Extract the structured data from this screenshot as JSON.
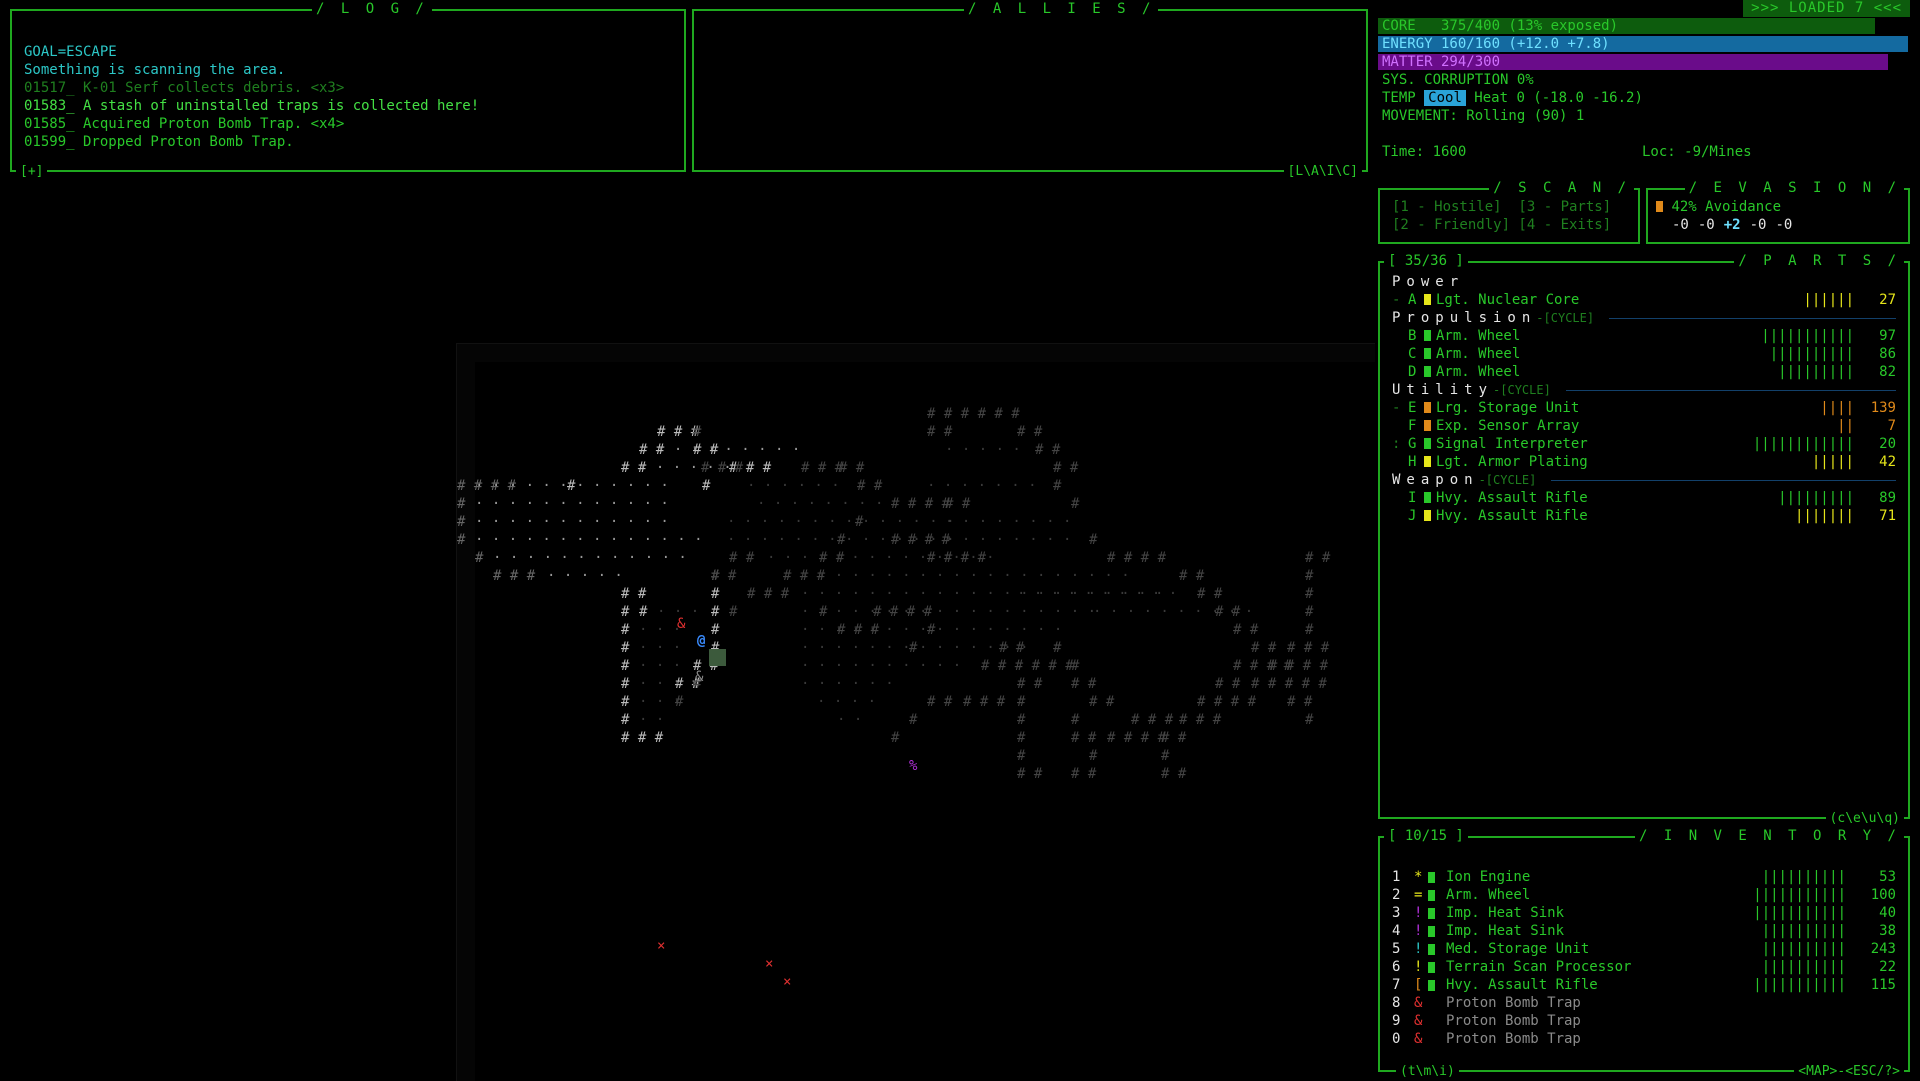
{
  "log": {
    "title": "/ L O G /",
    "footer": "[+]",
    "lines": [
      {
        "text": "GOAL=ESCAPE",
        "color": "#2cc7c7"
      },
      {
        "text": "Something is scanning the area.",
        "color": "#2cc7c7"
      },
      {
        "text": "01517_ K-01 Serf collects debris. <x3>",
        "color": "#1f7f1f"
      },
      {
        "text": "01583_ A stash of uninstalled traps is collected here!",
        "color": "#44e044"
      },
      {
        "text": "01585_ Acquired Proton Bomb Trap. <x4>",
        "color": "#29c82a"
      },
      {
        "text": "01599_ Dropped Proton Bomb Trap.",
        "color": "#29c82a"
      }
    ]
  },
  "allies": {
    "title": "/ A L L I E S /",
    "footer": "[L\\A\\I\\C]"
  },
  "status": {
    "loaded": ">>> LOADED 7 <<<",
    "core": "CORE   375/400 (13% exposed)",
    "energy": "ENERGY 160/160 (+12.0 +7.8)",
    "matter": "MATTER 294/300",
    "corruption": "SYS. CORRUPTION 0%",
    "temp_label": "TEMP ",
    "temp_state": "Cool",
    "heat": " Heat 0 (-18.0 -16.2)",
    "movement": "MOVEMENT: Rolling (90) 1",
    "time": "Time: 1600",
    "loc": "Loc: -9/Mines",
    "core_frac": 0.9375,
    "energy_frac": 1.0,
    "matter_frac": 0.98
  },
  "scan": {
    "title": "/ S C A N /",
    "line1": "[1 - Hostile]  [3 - Parts]",
    "line2": "[2 - Friendly] [4 - Exits]"
  },
  "evasion": {
    "title": "/ E V A S I O N /",
    "avoid": "42% Avoidance",
    "mods": [
      "-0",
      "-0",
      "+2",
      "-0",
      "-0"
    ]
  },
  "parts": {
    "title": "/ P A R T S /",
    "count": "[ 35/36 ]",
    "footer": "(c\\e\\u\\q)",
    "cycle": "-[CYCLE]",
    "categories": [
      {
        "name": "Power",
        "cycle": false,
        "items": [
          {
            "slot": "A",
            "name": "Lgt. Nuclear Core",
            "bars": "||||||",
            "num": "27",
            "sq": "#e6e61a",
            "numc": "#e6e61a",
            "mark": "-"
          }
        ]
      },
      {
        "name": "Propulsion",
        "cycle": true,
        "items": [
          {
            "slot": "B",
            "name": "Arm. Wheel",
            "bars": "|||||||||||",
            "num": "97",
            "sq": "#29c82a",
            "numc": "#29c82a",
            "mark": ""
          },
          {
            "slot": "C",
            "name": "Arm. Wheel",
            "bars": "||||||||||",
            "num": "86",
            "sq": "#29c82a",
            "numc": "#29c82a",
            "mark": ""
          },
          {
            "slot": "D",
            "name": "Arm. Wheel",
            "bars": "|||||||||",
            "num": "82",
            "sq": "#29c82a",
            "numc": "#29c82a",
            "mark": ""
          }
        ]
      },
      {
        "name": "Utility",
        "cycle": true,
        "items": [
          {
            "slot": "E",
            "name": "Lrg. Storage Unit",
            "bars": "||||",
            "num": "139",
            "sq": "#e08a1a",
            "numc": "#e08a1a",
            "mark": "-"
          },
          {
            "slot": "F",
            "name": "Exp. Sensor Array",
            "bars": "||",
            "num": "7",
            "sq": "#e08a1a",
            "numc": "#e08a1a",
            "mark": ""
          },
          {
            "slot": "G",
            "name": "Signal Interpreter",
            "bars": "||||||||||||",
            "num": "20",
            "sq": "#29c82a",
            "numc": "#29c82a",
            "mark": ":"
          },
          {
            "slot": "H",
            "name": "Lgt. Armor Plating",
            "bars": "|||||",
            "num": "42",
            "sq": "#e6e61a",
            "numc": "#e6e61a",
            "mark": ""
          }
        ]
      },
      {
        "name": "Weapon",
        "cycle": true,
        "items": [
          {
            "slot": "I",
            "name": "Hvy. Assault Rifle",
            "bars": "|||||||||",
            "num": "89",
            "sq": "#29c82a",
            "numc": "#29c82a",
            "mark": ""
          },
          {
            "slot": "J",
            "name": "Hvy. Assault Rifle",
            "bars": "|||||||",
            "num": "71",
            "sq": "#e6e61a",
            "numc": "#e6e61a",
            "mark": ""
          }
        ]
      }
    ]
  },
  "inventory": {
    "title": "/ I N V E N T O R Y /",
    "count": "[ 10/15 ]",
    "footer_left": "(t\\m\\i)",
    "footer_right": "<MAP>-<ESC/?>",
    "items": [
      {
        "n": "1",
        "g": "*",
        "gc": "#e6e61a",
        "sq": "#29c82a",
        "name": "Ion Engine",
        "bars": "||||||||||",
        "num": "53",
        "nc": "#29c82a"
      },
      {
        "n": "2",
        "g": "=",
        "gc": "#e6e61a",
        "sq": "#29c82a",
        "name": "Arm. Wheel",
        "bars": "|||||||||||",
        "num": "100",
        "nc": "#29c82a"
      },
      {
        "n": "3",
        "g": "!",
        "gc": "#b030d8",
        "sq": "#29c82a",
        "name": "Imp. Heat Sink",
        "bars": "|||||||||||",
        "num": "40",
        "nc": "#29c82a"
      },
      {
        "n": "4",
        "g": "!",
        "gc": "#b030d8",
        "sq": "#29c82a",
        "name": "Imp. Heat Sink",
        "bars": "||||||||||",
        "num": "38",
        "nc": "#29c82a"
      },
      {
        "n": "5",
        "g": "!",
        "gc": "#2cc7c7",
        "sq": "#29c82a",
        "name": "Med. Storage Unit",
        "bars": "||||||||||",
        "num": "243",
        "nc": "#29c82a"
      },
      {
        "n": "6",
        "g": "!",
        "gc": "#e6e61a",
        "sq": "#29c82a",
        "name": "Terrain Scan Processor",
        "bars": "||||||||||",
        "num": "22",
        "nc": "#29c82a"
      },
      {
        "n": "7",
        "g": "[",
        "gc": "#e08a1a",
        "sq": "#29c82a",
        "name": "Hvy. Assault Rifle",
        "bars": "|||||||||||",
        "num": "115",
        "nc": "#29c82a"
      },
      {
        "n": "8",
        "g": "&",
        "gc": "#e03030",
        "sq": "",
        "name": "Proton Bomb Trap",
        "bars": "",
        "num": "",
        "nc": "#8a8a8a"
      },
      {
        "n": "9",
        "g": "&",
        "gc": "#e03030",
        "sq": "",
        "name": "Proton Bomb Trap",
        "bars": "",
        "num": "",
        "nc": "#8a8a8a"
      },
      {
        "n": "0",
        "g": "&",
        "gc": "#e03030",
        "sq": "",
        "name": "Proton Bomb Trap",
        "bars": "",
        "num": "",
        "nc": "#8a8a8a"
      }
    ]
  },
  "map": {
    "player_glyph": "@",
    "trap_glyph": "&",
    "item_glyph": "%",
    "marker_glyph": "×"
  }
}
